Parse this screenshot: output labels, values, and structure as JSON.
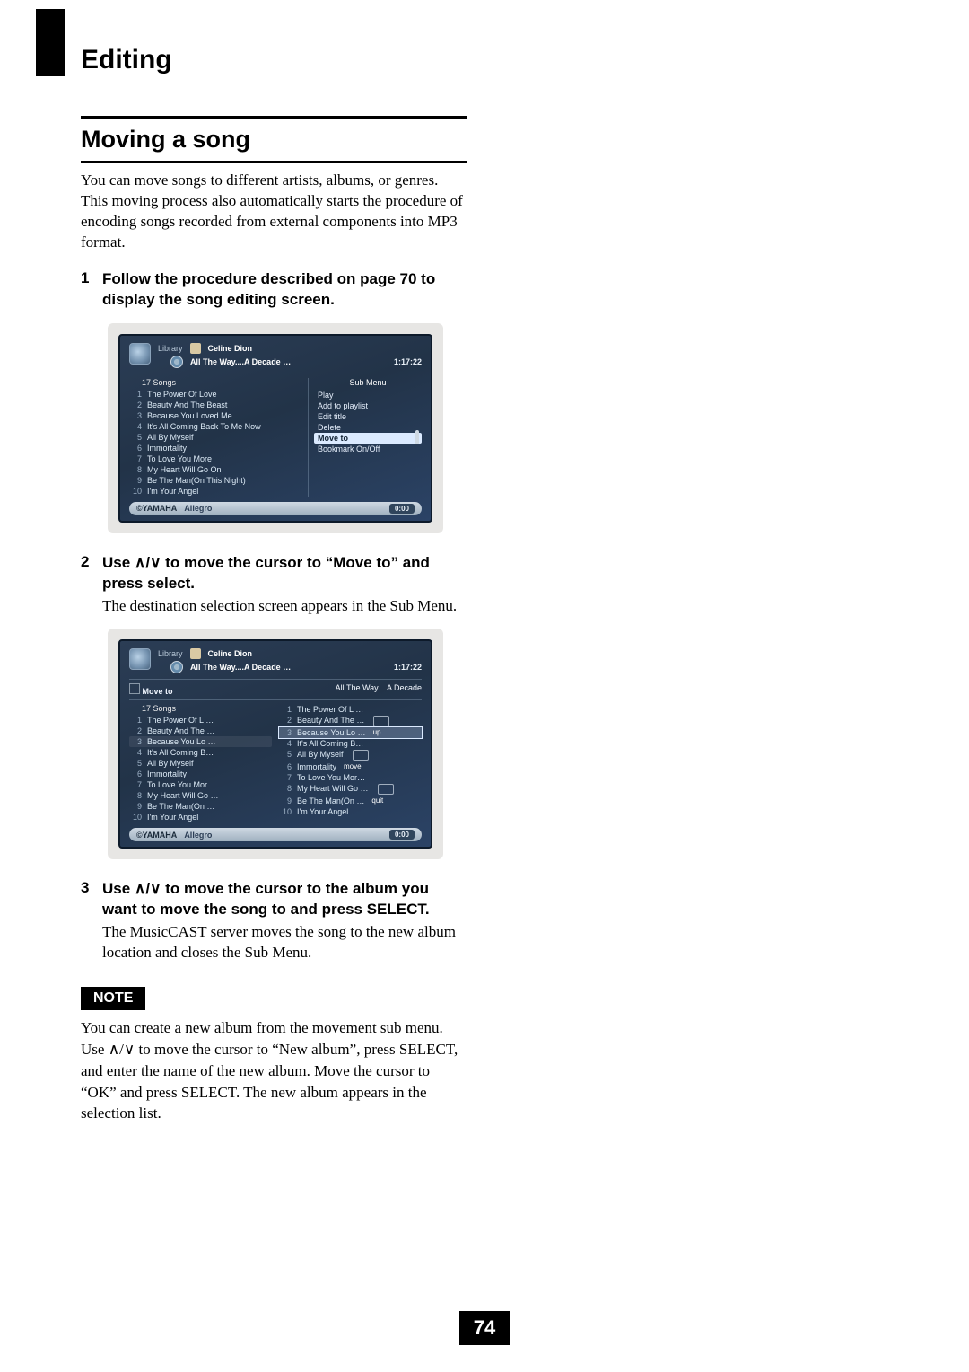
{
  "page_number": "74",
  "chapter": "Editing",
  "section": {
    "title": "Moving a song",
    "intro": "You can move songs to different artists, albums, or genres. This moving process also automatically starts the procedure of encoding songs recorded from external components into MP3 format.",
    "steps": [
      {
        "num": "1",
        "head": "Follow the procedure described on page 70 to display the song editing screen."
      },
      {
        "num": "2",
        "head": "Use ∧/∨ to move the cursor to “Move to” and press select.",
        "body": "The destination selection screen appears in the Sub Menu."
      },
      {
        "num": "3",
        "head": "Use ∧/∨ to move the cursor to the album you want to move the song to and press SELECT.",
        "body": "The MusicCAST server moves the song to the new album location and closes the Sub Menu."
      }
    ]
  },
  "note": {
    "label": "NOTE",
    "text": "You can create a new album from the movement sub menu. Use ∧/∨ to move the cursor to “New album”, press SELECT, and enter the name of the new album. Move the cursor to “OK” and press SELECT. The new album appears in the selection list."
  },
  "screen": {
    "breadcrumb": {
      "library": "Library",
      "artist": "Celine Dion",
      "album": "All The Way....A Decade …",
      "duration": "1:17:22"
    },
    "submenu_title": "Sub Menu",
    "submenu_items": [
      "Play",
      "Add to playlist",
      "Edit title",
      "Delete",
      "Move to",
      "Bookmark On/Off"
    ],
    "submenu_selected": "Move to",
    "song_count": "17",
    "songs_label": "Songs",
    "songs_full": [
      "The Power Of Love",
      "Beauty And The Beast",
      "Because You Loved Me",
      "It's All Coming Back To Me Now",
      "All By Myself",
      "Immortality",
      "To Love You More",
      "My Heart Will Go On",
      "Be The Man(On This Night)",
      "I'm Your Angel"
    ],
    "songs_short": [
      "The Power Of L …",
      "Beauty And The …",
      "Because You Lo …",
      "It's All Coming B…",
      "All By Myself",
      "Immortality",
      "To Love You Mor…",
      "My Heart Will Go …",
      "Be The Man(On …",
      "I'm Your Angel"
    ],
    "move_to": {
      "label": "Move to",
      "dest_album": "All The Way....A Decade",
      "hints": {
        "up": "up",
        "move": "move",
        "quit": "quit"
      },
      "selected_index": 3
    },
    "status": {
      "brand": "©YAMAHA",
      "track": "Allegro",
      "time": "0:00"
    }
  }
}
